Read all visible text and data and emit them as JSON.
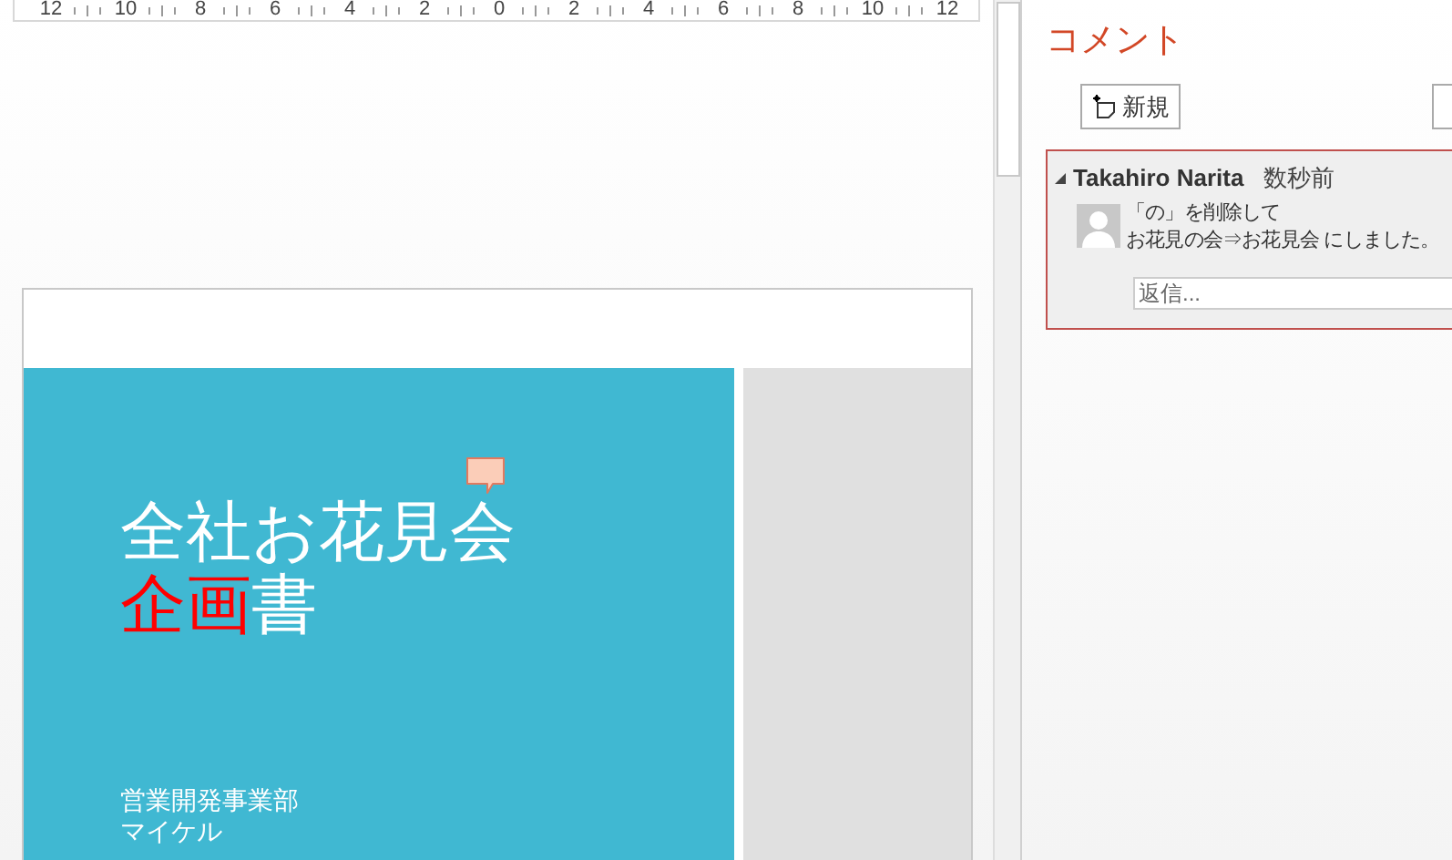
{
  "ruler": {
    "labels": [
      "12",
      "10",
      "8",
      "6",
      "4",
      "2",
      "0",
      "2",
      "4",
      "6",
      "8",
      "10",
      "12"
    ]
  },
  "slide": {
    "title_line1": "全社お花見会",
    "title_line2": [
      {
        "text": "企画",
        "color": "#ff0000"
      },
      {
        "text": "書",
        "color": "#ffffff"
      }
    ],
    "department": "営業開発事業部",
    "presenter": "マイケル"
  },
  "comments_panel": {
    "title": "コメント",
    "new_button": "新規",
    "comments": [
      {
        "author": "Takahiro Narita",
        "time": "数秒前",
        "expanded": true,
        "text_lines": [
          "「の」を削除して",
          "お花見の会⇒お花見会 にしました。"
        ],
        "reply_placeholder": "返信..."
      }
    ]
  }
}
